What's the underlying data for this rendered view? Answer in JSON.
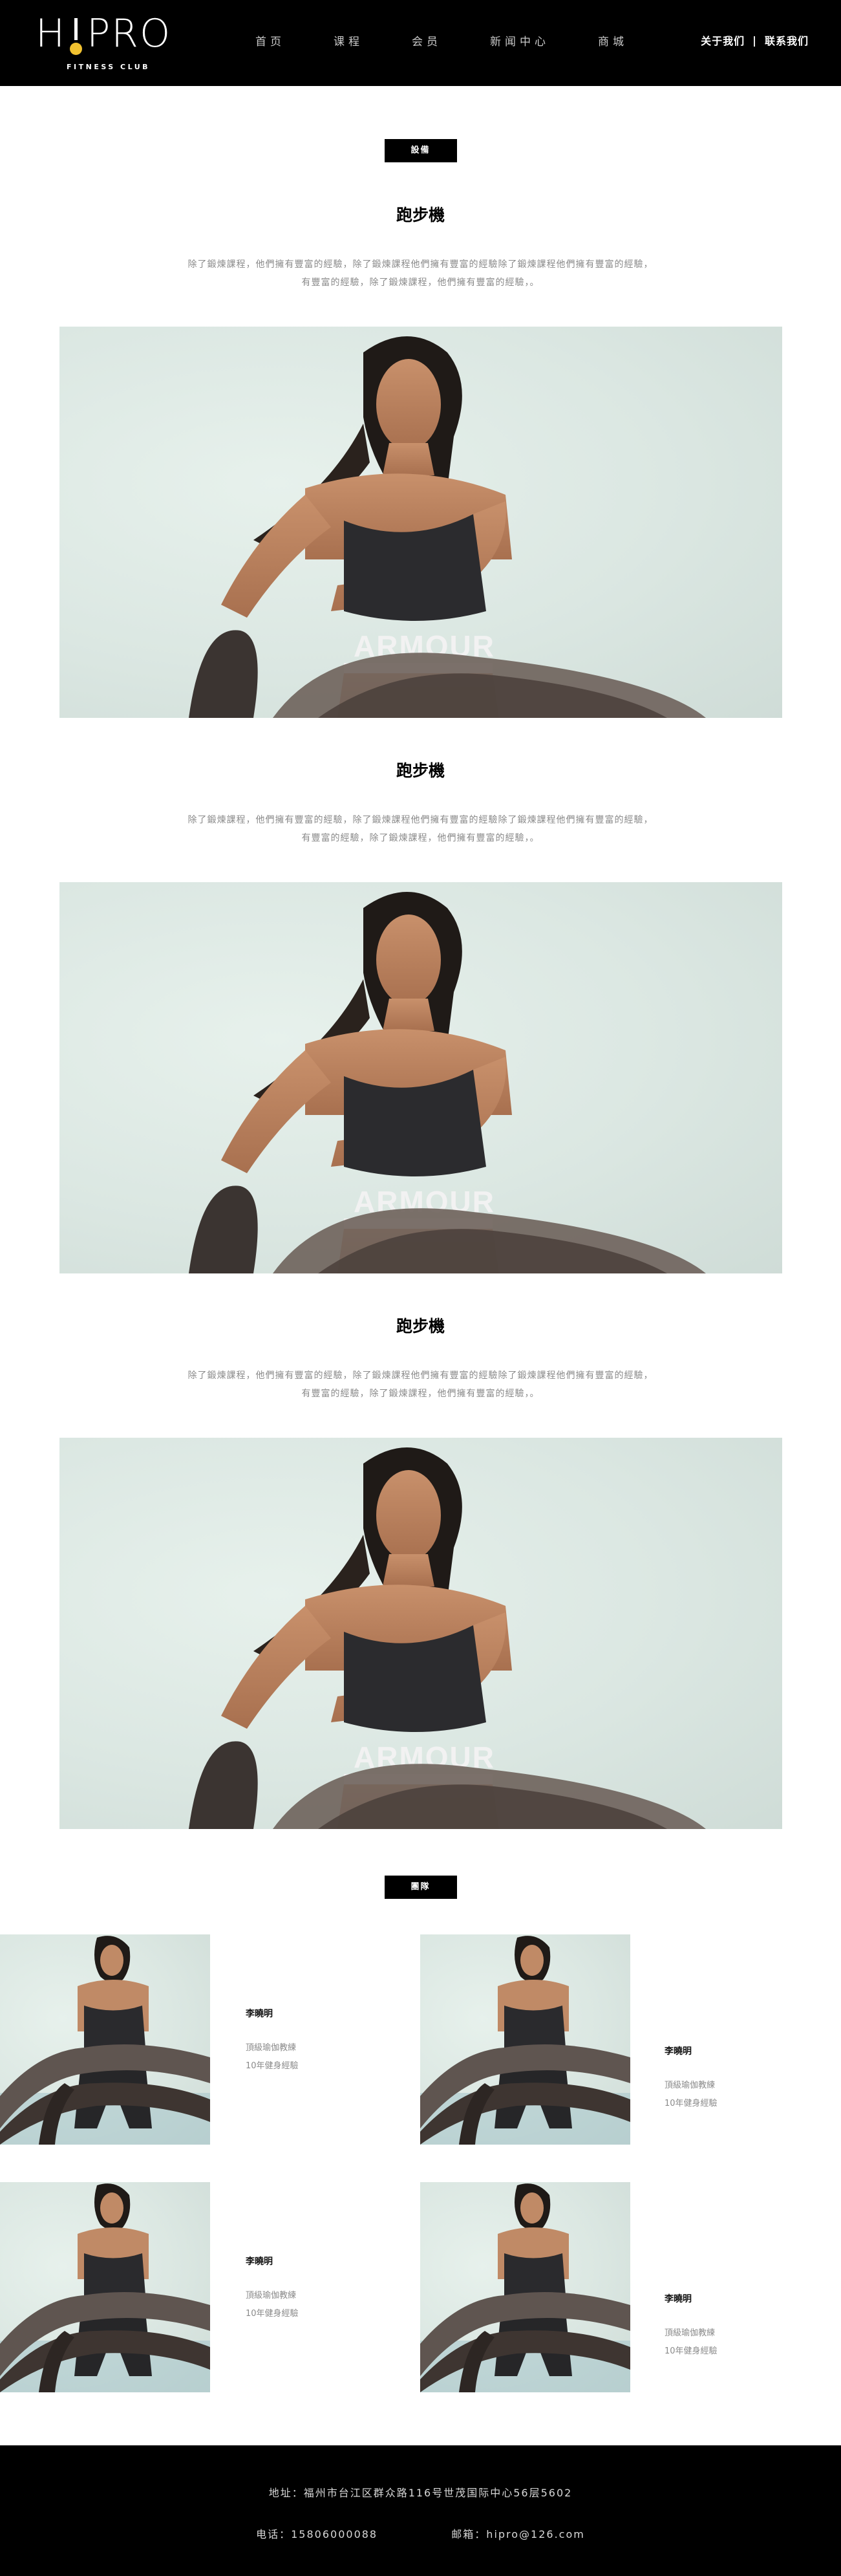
{
  "header": {
    "logo_main_left": "H",
    "logo_main_right": "PRO",
    "logo_sub": "FITNESS CLUB",
    "nav": [
      "首页",
      "课程",
      "会员",
      "新闻中心",
      "商城"
    ],
    "about_link": "关于我们",
    "separator": "|",
    "contact_link": "联系我们"
  },
  "equipment": {
    "tag": "設備",
    "blocks": [
      {
        "title": "跑步機",
        "desc_line1": "除了鍛煉課程，他們擁有豐富的經驗，除了鍛煉課程他們擁有豐富的經驗除了鍛煉課程他們擁有豐富的經驗，",
        "desc_line2": "有豐富的經驗，除了鍛煉課程，他們擁有豐富的經驗，。"
      },
      {
        "title": "跑步機",
        "desc_line1": "除了鍛煉課程，他們擁有豐富的經驗，除了鍛煉課程他們擁有豐富的經驗除了鍛煉課程他們擁有豐富的經驗，",
        "desc_line2": "有豐富的經驗，除了鍛煉課程，他們擁有豐富的經驗，。"
      },
      {
        "title": "跑步機",
        "desc_line1": "除了鍛煉課程，他們擁有豐富的經驗，除了鍛煉課程他們擁有豐富的經驗除了鍛煉課程他們擁有豐富的經驗，",
        "desc_line2": "有豐富的經驗，除了鍛煉課程，他們擁有豐富的經驗，。"
      }
    ],
    "image_shirt_text": "ARMOUR"
  },
  "team": {
    "tag": "團隊",
    "coaches": [
      {
        "name": "李曉明",
        "role": "頂級瑜伽教練",
        "years": "10年健身經驗"
      },
      {
        "name": "李曉明",
        "role": "頂級瑜伽教練",
        "years": "10年健身經驗"
      },
      {
        "name": "李曉明",
        "role": "頂級瑜伽教練",
        "years": "10年健身經驗"
      },
      {
        "name": "李曉明",
        "role": "頂級瑜伽教練",
        "years": "10年健身經驗"
      }
    ]
  },
  "footer": {
    "address": "地址：福州市台江区群众路116号世茂国际中心56层5602",
    "phone": "电话：15806000088",
    "email": "邮箱：hipro@126.com"
  },
  "colors": {
    "background": "#ffffff",
    "header_bg": "#000000",
    "logo_accent": "#f2c230",
    "body_text": "#8a8a8a"
  }
}
